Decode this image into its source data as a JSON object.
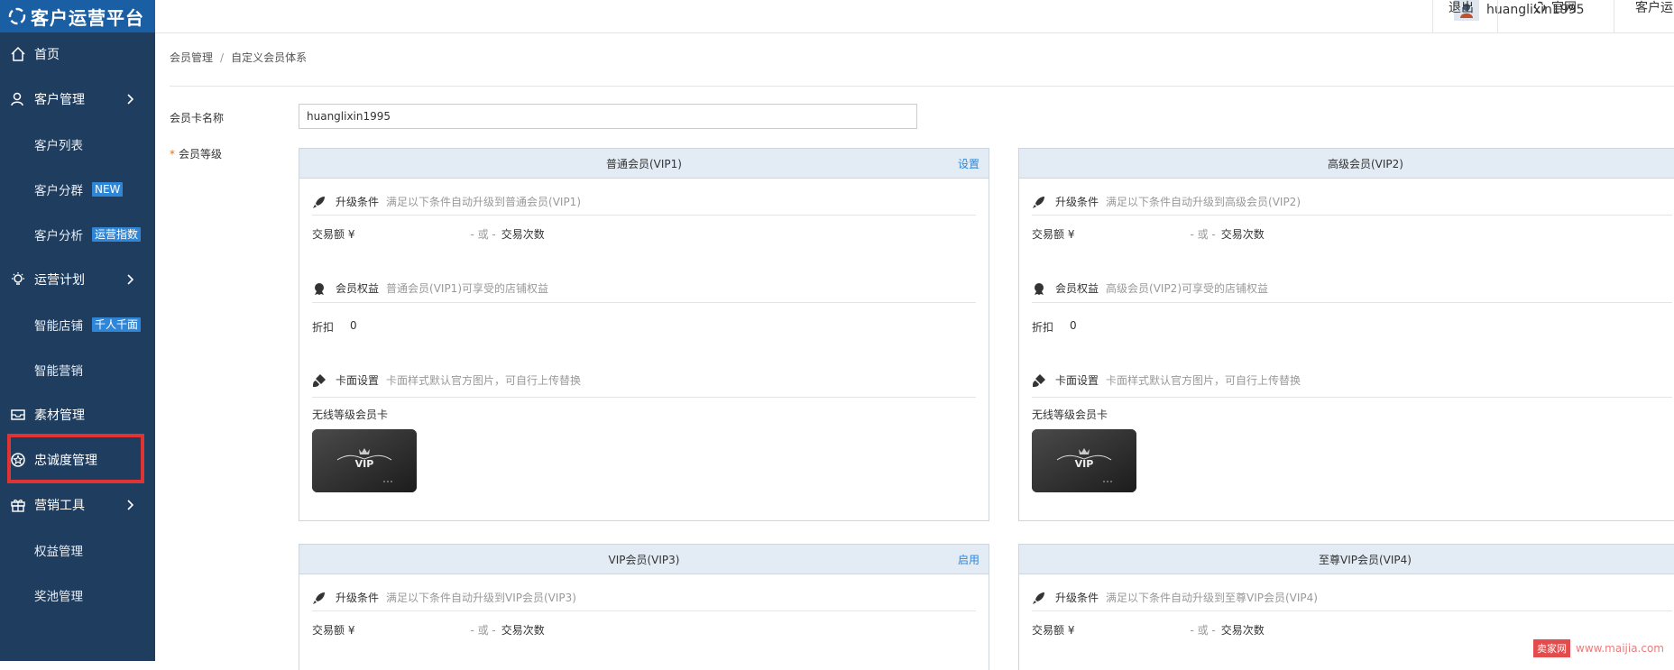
{
  "app": {
    "title": "客户运营平台"
  },
  "sidebar": {
    "items": [
      {
        "label": "首页",
        "icon": "home-icon"
      },
      {
        "label": "客户管理",
        "icon": "user-icon"
      },
      {
        "label": "客户列表"
      },
      {
        "label": "客户分群",
        "badge": "NEW"
      },
      {
        "label": "客户分析",
        "badge": "运营指数"
      },
      {
        "label": "运营计划",
        "icon": "lightbulb-icon"
      },
      {
        "label": "智能店铺",
        "badge": "千人千面"
      },
      {
        "label": "智能营销"
      },
      {
        "label": "素材管理",
        "icon": "mail-icon"
      },
      {
        "label": "忠诚度管理",
        "icon": "star-badge-icon"
      },
      {
        "label": "营销工具",
        "icon": "gift-icon"
      },
      {
        "label": "权益管理"
      },
      {
        "label": "奖池管理"
      }
    ]
  },
  "topbar": {
    "username": "huanglixin1995",
    "logout": "退出",
    "official_site": "官网",
    "customer_ops": "客户运"
  },
  "breadcrumb": {
    "parent": "会员管理",
    "separator": "/",
    "current": "自定义会员体系"
  },
  "form": {
    "card_name_label": "会员卡名称",
    "card_name_value": "huanglixin1995",
    "level_required_mark": "*",
    "level_label": "会员等级"
  },
  "levels": [
    {
      "title": "普通会员(VIP1)",
      "action": "设置",
      "upgrade_title": "升级条件",
      "upgrade_desc": "满足以下条件自动升级到普通会员(VIP1)",
      "trade_amount": "交易额 ¥",
      "or": "- 或 -",
      "trade_count": "交易次数",
      "rights_title": "会员权益",
      "rights_desc": "普通会员(VIP1)可享受的店铺权益",
      "discount_label": "折扣",
      "discount_value": "0",
      "card_title": "卡面设置",
      "card_desc": "卡面样式默认官方图片，可自行上传替换",
      "wireless_label": "无线等级会员卡",
      "vip_text": "VIP"
    },
    {
      "title": "高级会员(VIP2)",
      "action": "",
      "upgrade_title": "升级条件",
      "upgrade_desc": "满足以下条件自动升级到高级会员(VIP2)",
      "trade_amount": "交易额 ¥",
      "or": "- 或 -",
      "trade_count": "交易次数",
      "rights_title": "会员权益",
      "rights_desc": "高级会员(VIP2)可享受的店铺权益",
      "discount_label": "折扣",
      "discount_value": "0",
      "card_title": "卡面设置",
      "card_desc": "卡面样式默认官方图片，可自行上传替换",
      "wireless_label": "无线等级会员卡",
      "vip_text": "VIP"
    },
    {
      "title": "VIP会员(VIP3)",
      "action": "启用",
      "upgrade_title": "升级条件",
      "upgrade_desc": "满足以下条件自动升级到VIP会员(VIP3)",
      "trade_amount": "交易额 ¥",
      "or": "- 或 -",
      "trade_count": "交易次数"
    },
    {
      "title": "至尊VIP会员(VIP4)",
      "action": "",
      "upgrade_title": "升级条件",
      "upgrade_desc": "满足以下条件自动升级到至尊VIP会员(VIP4)",
      "trade_amount": "交易额 ¥",
      "or": "- 或 -",
      "trade_count": "交易次数"
    }
  ],
  "watermark": {
    "logo": "卖家网",
    "url": "www.maijia.com"
  },
  "colors": {
    "sidebar_bg": "#1f3d5f",
    "logo_bg": "#1a5fa4",
    "accent": "#2f86d6",
    "highlight": "#e03333"
  }
}
